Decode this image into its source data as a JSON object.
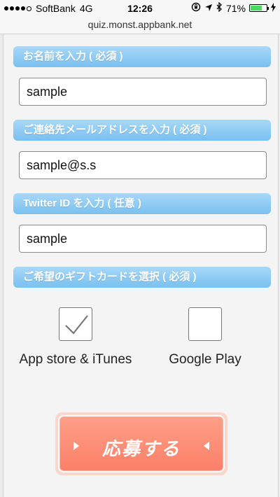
{
  "status_bar": {
    "carrier": "SoftBank",
    "network": "4G",
    "time": "12:26",
    "battery_percent": "71%",
    "battery_level": 0.71,
    "signal_bars_filled": 4,
    "signal_bars_total": 5
  },
  "browser": {
    "url": "quiz.monst.appbank.net"
  },
  "form": {
    "name_label": "お名前を入力 ( 必須 )",
    "name_value": "sample",
    "email_label": "ご連絡先メールアドレスを入力 ( 必須 )",
    "email_value": "sample@s.s",
    "twitter_label": "Twitter ID を入力 ( 任意 )",
    "twitter_value": "sample",
    "gift_label": "ご希望のギフトカードを選択 ( 必須 )",
    "gift_options": [
      {
        "label": "App store & iTunes",
        "checked": true
      },
      {
        "label": "Google Play",
        "checked": false
      }
    ],
    "submit_label": "応募する"
  },
  "colors": {
    "section_header": "#79c0f0",
    "submit_button": "#fb7f68",
    "battery": "#4cd964"
  }
}
